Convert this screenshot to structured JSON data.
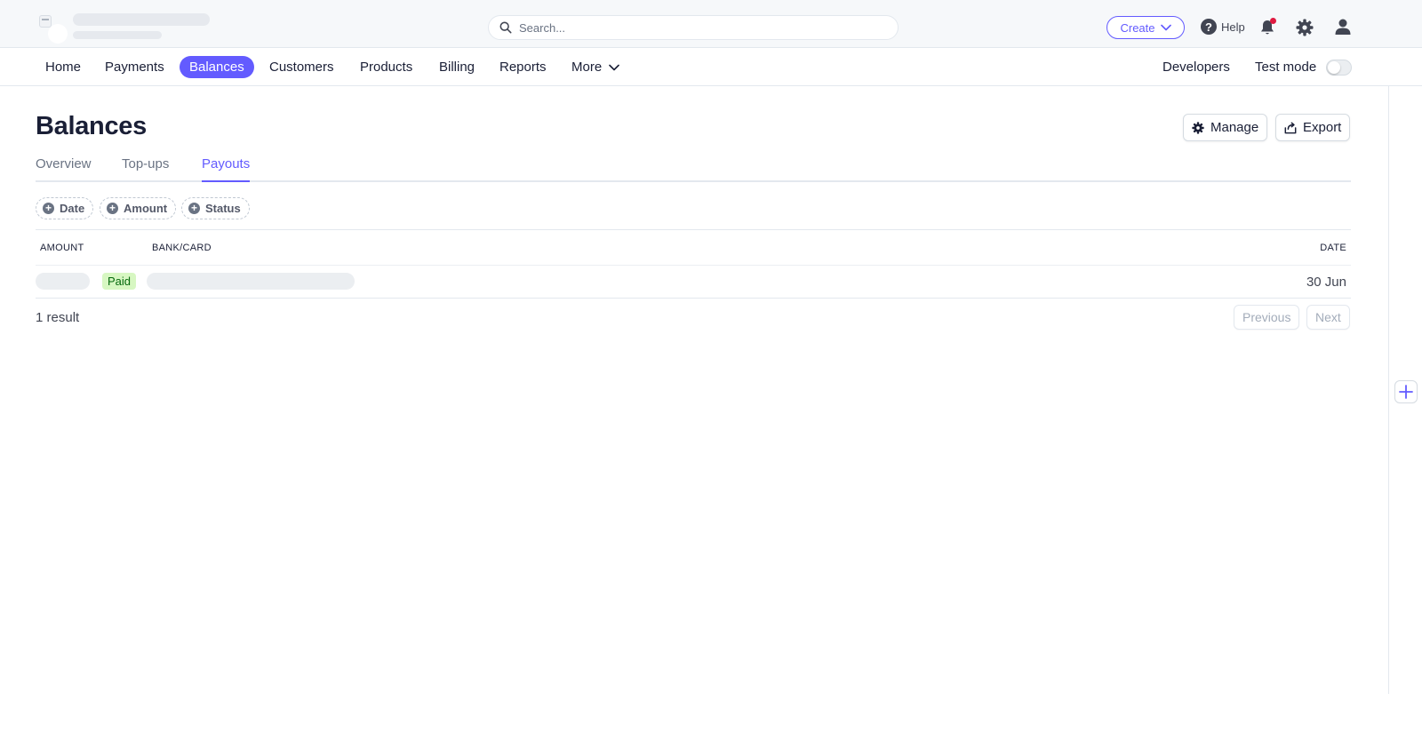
{
  "search": {
    "placeholder": "Search..."
  },
  "header": {
    "create_label": "Create",
    "help_label": "Help"
  },
  "nav": {
    "items": [
      {
        "label": "Home"
      },
      {
        "label": "Payments"
      },
      {
        "label": "Balances",
        "active": true
      },
      {
        "label": "Customers"
      },
      {
        "label": "Products"
      },
      {
        "label": "Billing"
      },
      {
        "label": "Reports"
      },
      {
        "label": "More"
      }
    ],
    "developers_label": "Developers",
    "test_mode_label": "Test mode",
    "test_mode_on": false
  },
  "page": {
    "title": "Balances",
    "manage_label": "Manage",
    "export_label": "Export"
  },
  "tabs": [
    {
      "label": "Overview"
    },
    {
      "label": "Top-ups"
    },
    {
      "label": "Payouts",
      "active": true
    }
  ],
  "filters": [
    {
      "label": "Date"
    },
    {
      "label": "Amount"
    },
    {
      "label": "Status"
    }
  ],
  "table": {
    "columns": [
      "AMOUNT",
      "BANK/CARD",
      "DATE"
    ],
    "rows": [
      {
        "status": "Paid",
        "date": "30 Jun"
      }
    ]
  },
  "pagination": {
    "result_text": "1 result",
    "previous_label": "Previous",
    "next_label": "Next"
  },
  "colors": {
    "accent": "#635bff",
    "paid_badge_bg": "#d7f7c2",
    "paid_badge_text": "#05690d",
    "notification_dot": "#df1b41"
  }
}
